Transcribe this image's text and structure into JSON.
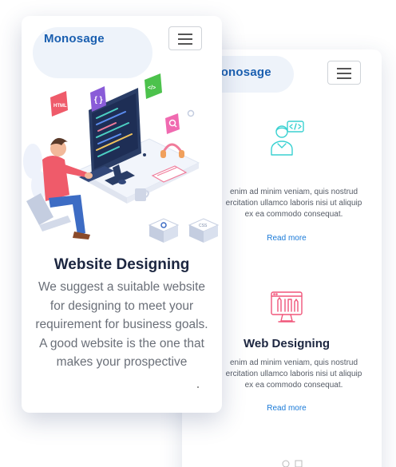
{
  "brand": {
    "name": "Monosage",
    "color": "#1a5fb0",
    "accent": "#1a7ad8"
  },
  "back_phone": {
    "menu_icon": "hamburger-icon",
    "features": [
      {
        "icon": "developer-user-icon",
        "icon_color": "#3ad1d1",
        "title": "",
        "desc_lines": [
          "enim ad minim veniam, quis nostrud",
          "ercitation ullamco laboris nisi ut aliquip",
          "ex ea commodo consequat."
        ],
        "link": "Read more"
      },
      {
        "icon": "monitor-tools-icon",
        "icon_color": "#f0567a",
        "title": "Web Designing",
        "desc_lines": [
          "enim ad minim veniam, quis nostrud",
          "ercitation ullamco laboris nisi ut aliquip",
          "ex ea commodo consequat."
        ],
        "link": "Read more"
      }
    ]
  },
  "front_phone": {
    "menu_icon": "hamburger-icon",
    "hero_illustration": "developer-workstation-illustration",
    "badges": [
      "HTML",
      "</>"
    ],
    "title": "Website Designing",
    "text_lines": [
      "We suggest a suitable website",
      "for designing to meet your",
      "requirement for business goals.",
      "A good website is the one that",
      "makes your prospective"
    ]
  }
}
